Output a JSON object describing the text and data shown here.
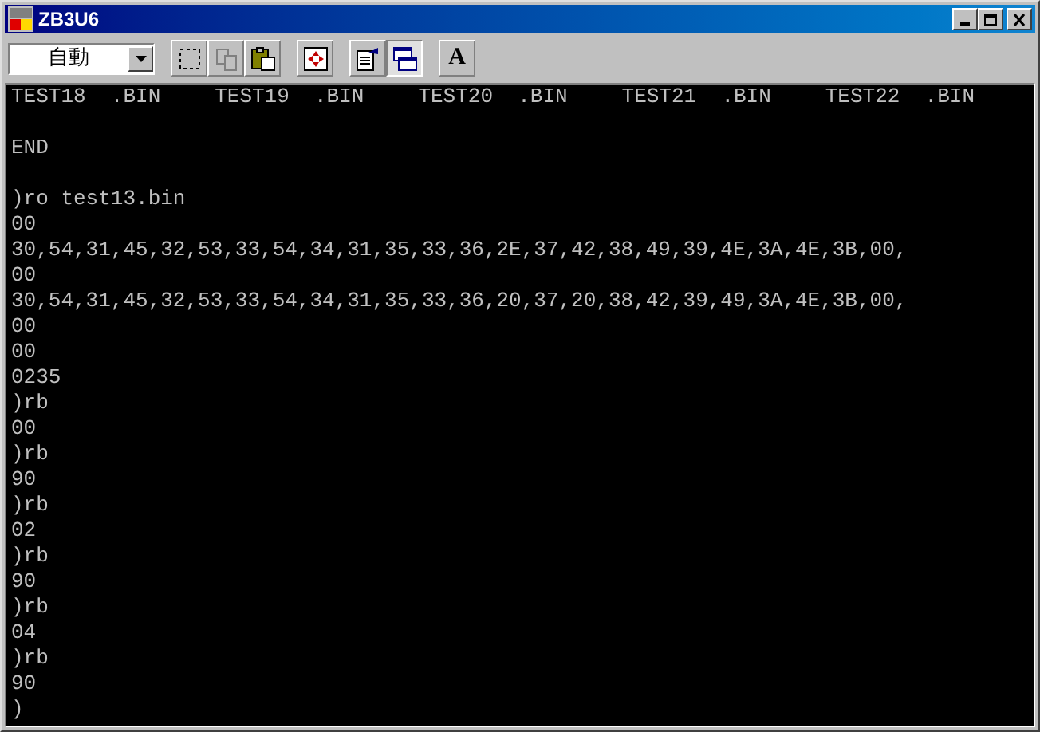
{
  "window": {
    "title": "ZB3U6"
  },
  "toolbar": {
    "font_size_select": {
      "value": "自動"
    },
    "button_groups": [
      [
        {
          "kind": "select-region",
          "pressed": false
        },
        {
          "kind": "copy",
          "pressed": false
        },
        {
          "kind": "paste",
          "pressed": false
        }
      ],
      [
        {
          "kind": "fullscreen",
          "pressed": false
        }
      ],
      [
        {
          "kind": "properties",
          "pressed": false
        },
        {
          "kind": "background",
          "pressed": true
        }
      ],
      [
        {
          "kind": "font",
          "pressed": false,
          "label": "A"
        }
      ]
    ]
  },
  "terminal": {
    "files": [
      "TEST18  .BIN",
      "TEST19  .BIN",
      "TEST20  .BIN",
      "TEST21  .BIN",
      "TEST22  .BIN"
    ],
    "end_text": "END",
    "lines": [
      ")ro test13.bin",
      "00",
      "30,54,31,45,32,53,33,54,34,31,35,33,36,2E,37,42,38,49,39,4E,3A,4E,3B,00,",
      "00",
      "30,54,31,45,32,53,33,54,34,31,35,33,36,20,37,20,38,42,39,49,3A,4E,3B,00,",
      "00",
      "00",
      "0235",
      ")rb",
      "00",
      ")rb",
      "90",
      ")rb",
      "02",
      ")rb",
      "90",
      ")rb",
      "04",
      ")rb",
      "90",
      ")"
    ]
  }
}
